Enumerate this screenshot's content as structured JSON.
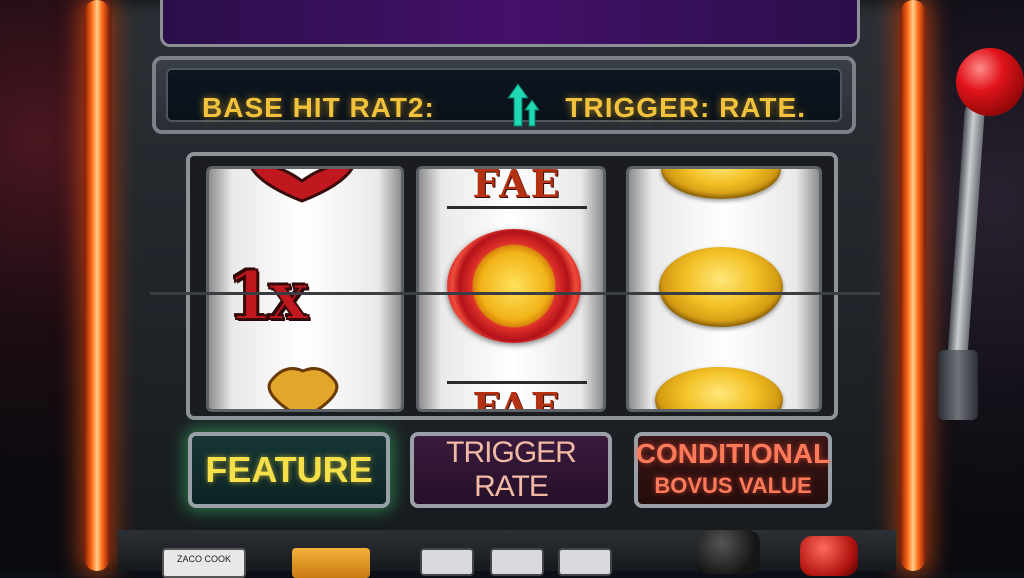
{
  "marquee": {
    "title": ""
  },
  "info_bar": {
    "left_label": "BASE HIT RAT2:",
    "right_label": "TRIGGER: RATE.",
    "arrows_icon": "double-up-arrow-icon"
  },
  "reels": [
    {
      "symbols": [
        "heart",
        "1x",
        "gold-heart"
      ],
      "middle_text": "1x"
    },
    {
      "symbols": [
        "FAE",
        "red-gold-coin",
        "FAE"
      ],
      "top_text": "FAE",
      "bottom_text": "FAE"
    },
    {
      "symbols": [
        "gold-coin",
        "gold-coin",
        "gold-coin"
      ]
    }
  ],
  "buttons": {
    "feature": "FEATURE",
    "trigger_rate": "TRIGGER RATE",
    "conditional_line1": "CONDITIONAL",
    "conditional_line2": "BOVUS VALUE"
  },
  "deck": {
    "cook_label": "ZACO COOK"
  },
  "colors": {
    "neon_orange": "#ff6a1a",
    "info_text": "#f2c23c",
    "feature_text": "#f6e04a",
    "lever_knob": "#e0141a"
  }
}
